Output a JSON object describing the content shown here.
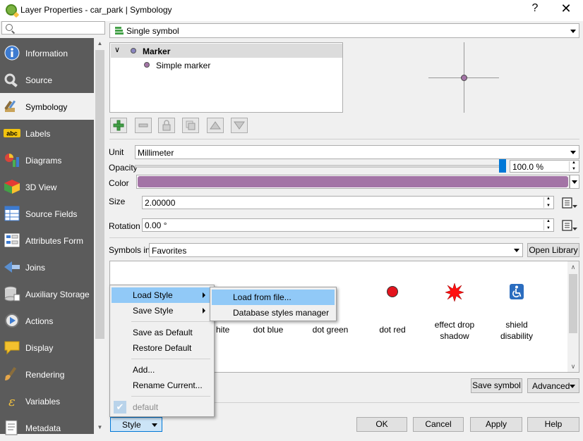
{
  "window": {
    "title": "Layer Properties - car_park | Symbology",
    "help": "?",
    "close": "✕"
  },
  "search": {
    "placeholder": ""
  },
  "sidebar": {
    "items": [
      {
        "label": "Information",
        "icon": "info-icon"
      },
      {
        "label": "Source",
        "icon": "source-icon"
      },
      {
        "label": "Symbology",
        "icon": "symbology-icon"
      },
      {
        "label": "Labels",
        "icon": "labels-icon"
      },
      {
        "label": "Diagrams",
        "icon": "diagrams-icon"
      },
      {
        "label": "3D View",
        "icon": "3d-view-icon"
      },
      {
        "label": "Source Fields",
        "icon": "source-fields-icon"
      },
      {
        "label": "Attributes Form",
        "icon": "attributes-form-icon"
      },
      {
        "label": "Joins",
        "icon": "joins-icon"
      },
      {
        "label": "Auxiliary Storage",
        "icon": "auxiliary-storage-icon"
      },
      {
        "label": "Actions",
        "icon": "actions-icon"
      },
      {
        "label": "Display",
        "icon": "display-icon"
      },
      {
        "label": "Rendering",
        "icon": "rendering-icon"
      },
      {
        "label": "Variables",
        "icon": "variables-icon"
      },
      {
        "label": "Metadata",
        "icon": "metadata-icon"
      }
    ],
    "active_label": "Symbology"
  },
  "renderer": {
    "selected": "Single symbol"
  },
  "symbol_tree": {
    "root": "Marker",
    "child": "Simple marker"
  },
  "props": {
    "unit_label": "Unit",
    "unit_value": "Millimeter",
    "opacity_label": "Opacity",
    "opacity_value": "100.0 %",
    "opacity_fraction": 1.0,
    "color_label": "Color",
    "color_value": "#a374a6",
    "size_label": "Size",
    "size_value": "2.00000",
    "rotation_label": "Rotation",
    "rotation_value": "0.00 °"
  },
  "symbols": {
    "label": "Symbols in",
    "group": "Favorites",
    "open_library": "Open Library",
    "items": [
      {
        "name": "dot white"
      },
      {
        "name": "dot blue"
      },
      {
        "name": "dot green"
      },
      {
        "name": "dot red"
      },
      {
        "name": "effect drop shadow"
      },
      {
        "name": "shield disability"
      }
    ],
    "visible_labels": [
      "hite",
      "dot blue",
      "dot green",
      "dot red",
      "effect drop\nshadow",
      "shield\ndisability"
    ]
  },
  "buttons": {
    "save_symbol": "Save symbol",
    "advanced": "Advanced",
    "style": "Style",
    "ok": "OK",
    "cancel": "Cancel",
    "apply": "Apply",
    "help": "Help"
  },
  "style_menu": {
    "load_style": "Load Style",
    "save_style": "Save Style",
    "save_default": "Save as Default",
    "restore_default": "Restore Default",
    "add": "Add...",
    "rename": "Rename Current...",
    "default": "default"
  },
  "load_submenu": {
    "from_file": "Load from file...",
    "db_manager": "Database styles manager"
  },
  "colors": {
    "sidebar_bg": "#5b5b5b",
    "highlight": "#91c9f7",
    "accent_blue": "#0078d7",
    "symbol_purple": "#a374a6"
  }
}
